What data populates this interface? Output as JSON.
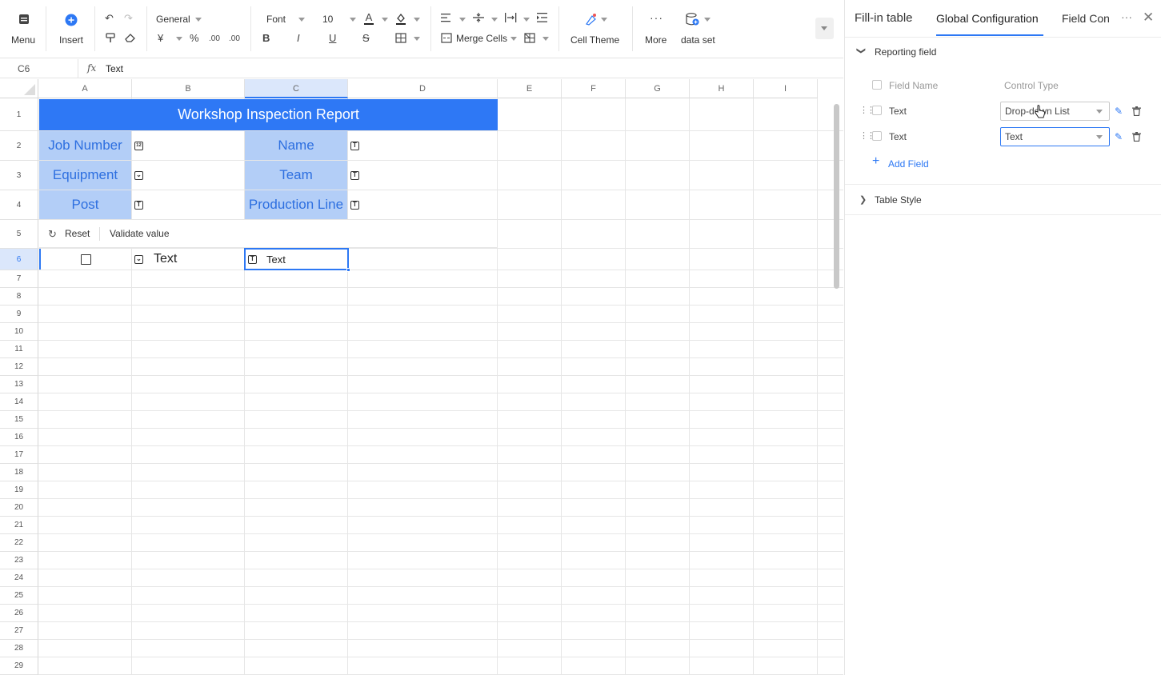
{
  "toolbar": {
    "menu": "Menu",
    "insert": "Insert",
    "number_format": "General",
    "font": "Font",
    "font_size": "10",
    "merge_cells": "Merge Cells",
    "cell_theme": "Cell Theme",
    "more": "More",
    "data_set": "data set",
    "accent_color": "#2d78f4"
  },
  "formula": {
    "cell_ref": "C6",
    "fx": "fx",
    "value": "Text"
  },
  "columns": [
    "A",
    "B",
    "C",
    "D",
    "E",
    "F",
    "G",
    "H",
    "I"
  ],
  "rows": [
    "1",
    "2",
    "3",
    "4",
    "5",
    "6",
    "7",
    "8",
    "9",
    "10",
    "11",
    "12",
    "13",
    "14",
    "15",
    "16",
    "17",
    "18",
    "19",
    "20",
    "21",
    "22",
    "23",
    "24",
    "25",
    "26",
    "27",
    "28",
    "29"
  ],
  "sheet": {
    "title": "Workshop Inspection Report",
    "labels": {
      "job_number": "Job Number",
      "name": "Name",
      "equipment": "Equipment",
      "team": "Team",
      "post": "Post",
      "production_line": "Production Line"
    },
    "reset": "Reset",
    "validate": "Validate value",
    "row6_b": "Text",
    "row6_c": "Text",
    "header_color": "#2e78f5",
    "label_bg": "#b3cef7"
  },
  "panel": {
    "tabs": [
      "Fill-in table",
      "Global Configuration",
      "Field Con"
    ],
    "section_reporting": "Reporting field",
    "col_field_name": "Field Name",
    "col_control_type": "Control Type",
    "fields": [
      {
        "name": "Text",
        "control": "Drop-down List"
      },
      {
        "name": "Text",
        "control": "Text"
      }
    ],
    "add_field": "Add Field",
    "section_style": "Table Style"
  }
}
